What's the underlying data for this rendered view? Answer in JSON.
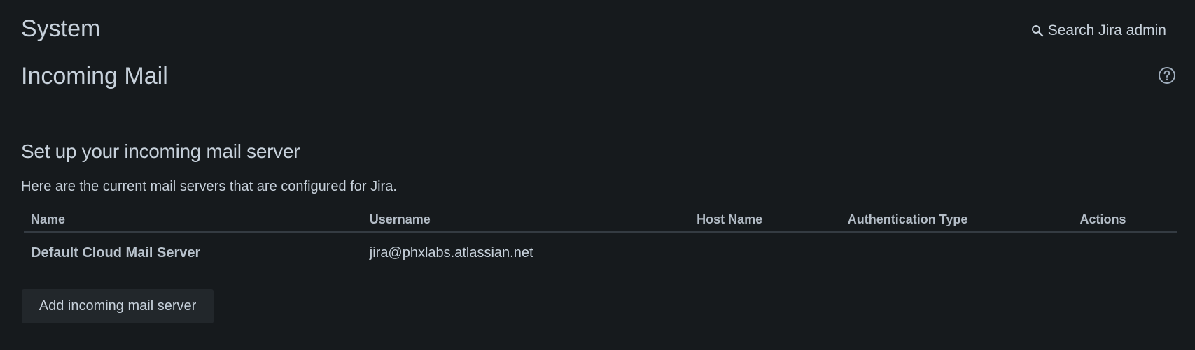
{
  "header": {
    "section_title": "System",
    "search_label": "Search Jira admin",
    "search_icon": "search-icon"
  },
  "page": {
    "title": "Incoming Mail",
    "help_icon": "question-circle-icon"
  },
  "content": {
    "heading": "Set up your incoming mail server",
    "description": "Here are the current mail servers that are configured for Jira.",
    "table": {
      "columns": [
        "Name",
        "Username",
        "Host Name",
        "Authentication Type",
        "Actions"
      ],
      "rows": [
        {
          "name": "Default Cloud Mail Server",
          "username": "jira@phxlabs.atlassian.net",
          "host_name": "",
          "authentication_type": "",
          "actions": ""
        }
      ]
    },
    "add_button_label": "Add incoming mail server"
  },
  "colors": {
    "background": "#161a1d",
    "text": "#c7d1db",
    "button_background": "#22272b",
    "table_divider": "#343b42"
  }
}
